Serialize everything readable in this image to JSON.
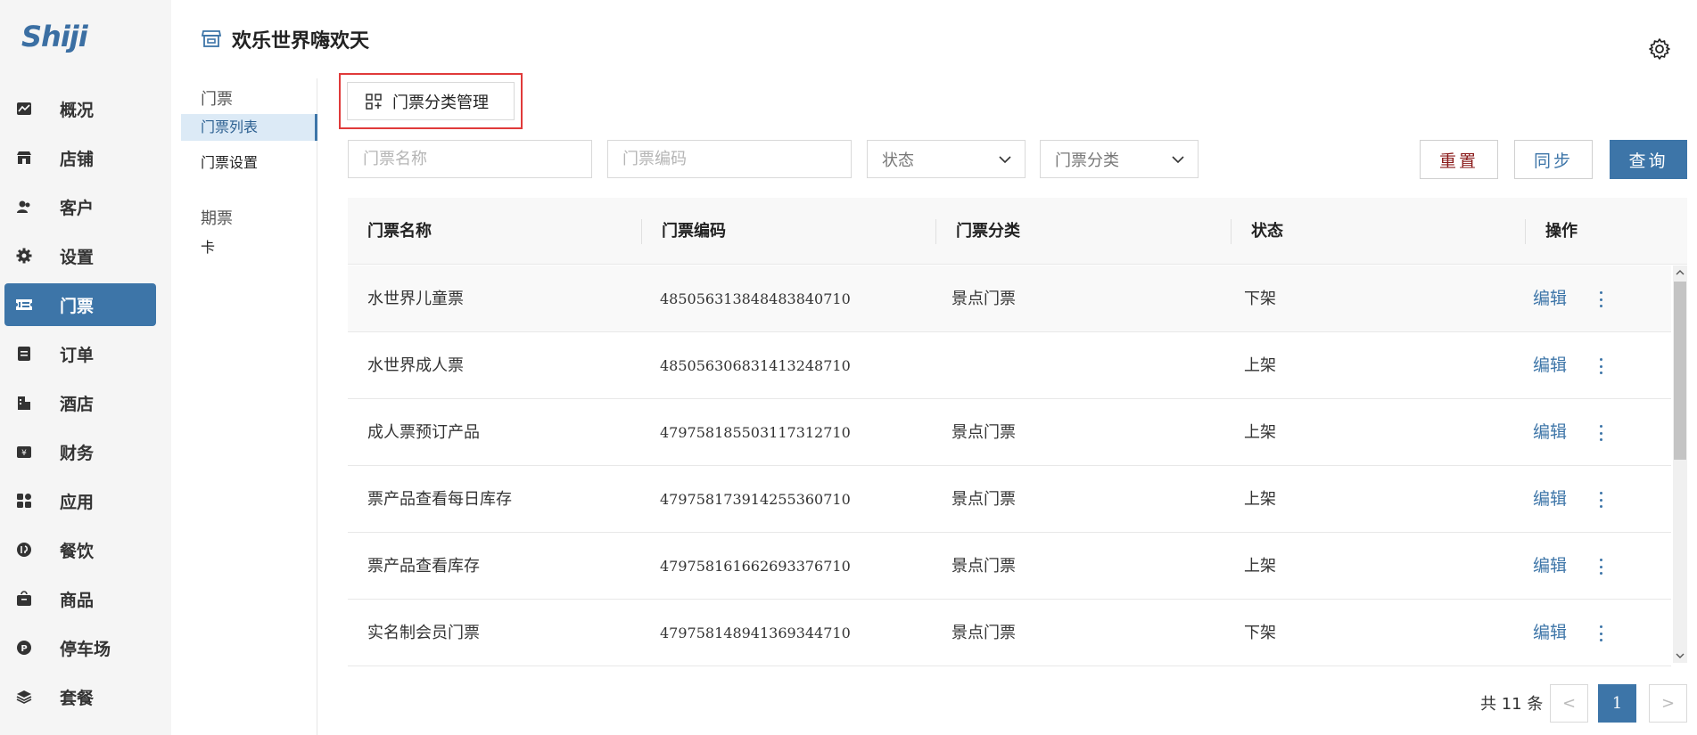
{
  "brand": {
    "logo_text": "Shiji",
    "accent": "#3d75a8"
  },
  "nav": {
    "items": [
      {
        "label": "概况",
        "icon": "chart-icon"
      },
      {
        "label": "店铺",
        "icon": "store-icon"
      },
      {
        "label": "客户",
        "icon": "users-icon"
      },
      {
        "label": "设置",
        "icon": "gear-icon"
      },
      {
        "label": "门票",
        "icon": "ticket-icon",
        "active": true
      },
      {
        "label": "订单",
        "icon": "order-icon"
      },
      {
        "label": "酒店",
        "icon": "hotel-icon"
      },
      {
        "label": "财务",
        "icon": "finance-icon"
      },
      {
        "label": "应用",
        "icon": "apps-icon"
      },
      {
        "label": "餐饮",
        "icon": "dining-icon"
      },
      {
        "label": "商品",
        "icon": "goods-icon"
      },
      {
        "label": "停车场",
        "icon": "parking-icon"
      },
      {
        "label": "套餐",
        "icon": "package-icon"
      }
    ]
  },
  "header": {
    "title": "欢乐世界嗨欢天",
    "icon": "store-front-icon"
  },
  "subnav": {
    "group1": "门票",
    "item_list": "门票列表",
    "item_settings": "门票设置",
    "group2": "期票",
    "item_card": "卡"
  },
  "toolbar": {
    "category_manage": "门票分类管理"
  },
  "filters": {
    "name_placeholder": "门票名称",
    "code_placeholder": "门票编码",
    "status_select": "状态",
    "category_select": "门票分类",
    "reset": "重置",
    "sync": "同步",
    "query": "查询"
  },
  "table": {
    "columns": [
      "门票名称",
      "门票编码",
      "门票分类",
      "状态",
      "操作"
    ],
    "rows": [
      {
        "name": "水世界儿童票",
        "code": "485056313848483840710",
        "category": "景点门票",
        "status": "下架",
        "action": "编辑"
      },
      {
        "name": "水世界成人票",
        "code": "485056306831413248710",
        "category": "",
        "status": "上架",
        "action": "编辑"
      },
      {
        "name": "成人票预订产品",
        "code": "479758185503117312710",
        "category": "景点门票",
        "status": "上架",
        "action": "编辑"
      },
      {
        "name": "票产品查看每日库存",
        "code": "479758173914255360710",
        "category": "景点门票",
        "status": "上架",
        "action": "编辑"
      },
      {
        "name": "票产品查看库存",
        "code": "479758161662693376710",
        "category": "景点门票",
        "status": "上架",
        "action": "编辑"
      },
      {
        "name": "实名制会员门票",
        "code": "479758148941369344710",
        "category": "景点门票",
        "status": "下架",
        "action": "编辑"
      }
    ]
  },
  "pagination": {
    "total": "共 11 条",
    "current": "1",
    "prev": "<",
    "next": ">"
  }
}
